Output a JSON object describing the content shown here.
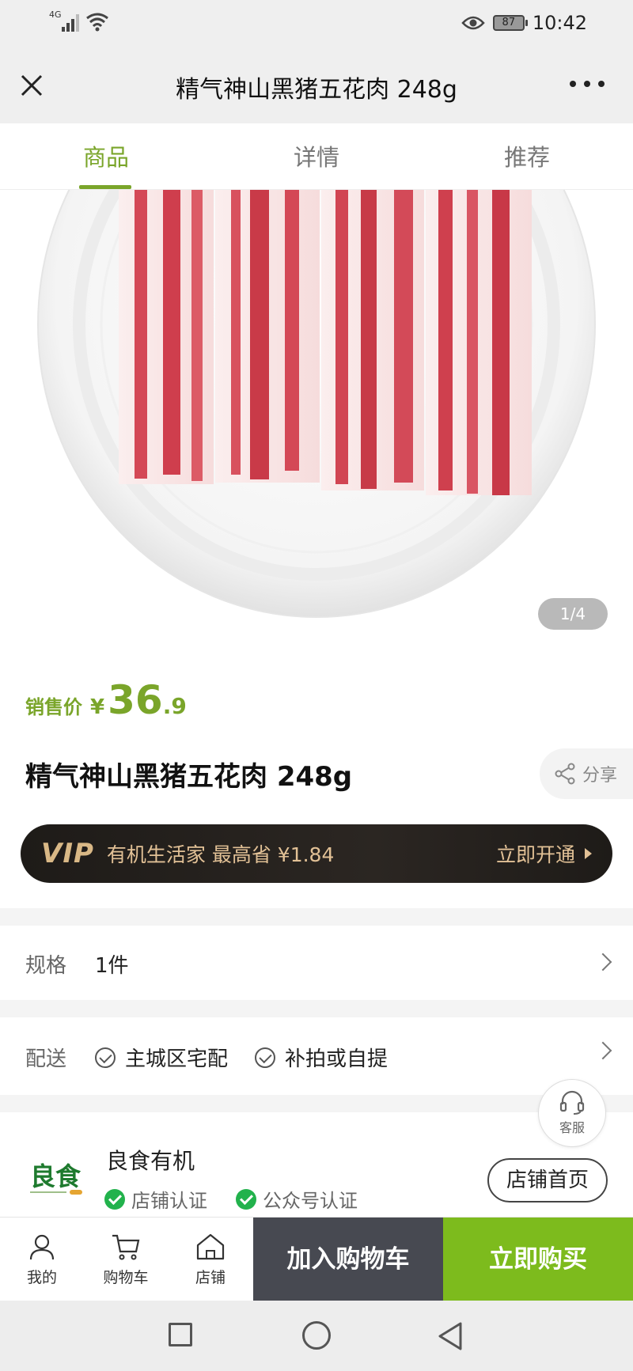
{
  "status_bar": {
    "network": "4G",
    "battery": "87",
    "time": "10:42"
  },
  "header": {
    "title": "精气神山黑猪五花肉 248g"
  },
  "tabs": [
    {
      "label": "商品",
      "active": true
    },
    {
      "label": "详情",
      "active": false
    },
    {
      "label": "推荐",
      "active": false
    }
  ],
  "gallery": {
    "pager": "1/4"
  },
  "price": {
    "label": "销售价",
    "currency": "¥",
    "integer": "36",
    "decimal": ".9"
  },
  "product": {
    "name": "精气神山黑猪五花肉 248g",
    "share_label": "分享"
  },
  "vip": {
    "badge": "VIP",
    "text": "有机生活家  最高省 ¥1.84",
    "cta": "立即开通"
  },
  "spec": {
    "label": "规格",
    "value": "1件"
  },
  "delivery": {
    "label": "配送",
    "options": [
      "主城区宅配",
      "补拍或自提"
    ]
  },
  "service": {
    "label": "客服"
  },
  "store": {
    "name": "良食有机",
    "logo_text": "良食",
    "badges": [
      "店铺认证",
      "公众号认证"
    ],
    "home_button": "店铺首页"
  },
  "bottom_nav": {
    "items": [
      {
        "label": "我的",
        "icon": "user-icon"
      },
      {
        "label": "购物车",
        "icon": "cart-icon"
      },
      {
        "label": "店铺",
        "icon": "store-icon"
      }
    ],
    "add_to_cart": "加入购物车",
    "buy_now": "立即购买"
  },
  "colors": {
    "accent": "#7aa52a",
    "buy": "#7dbb1d",
    "cart": "#474951",
    "vip_gold": "#e2c196"
  }
}
